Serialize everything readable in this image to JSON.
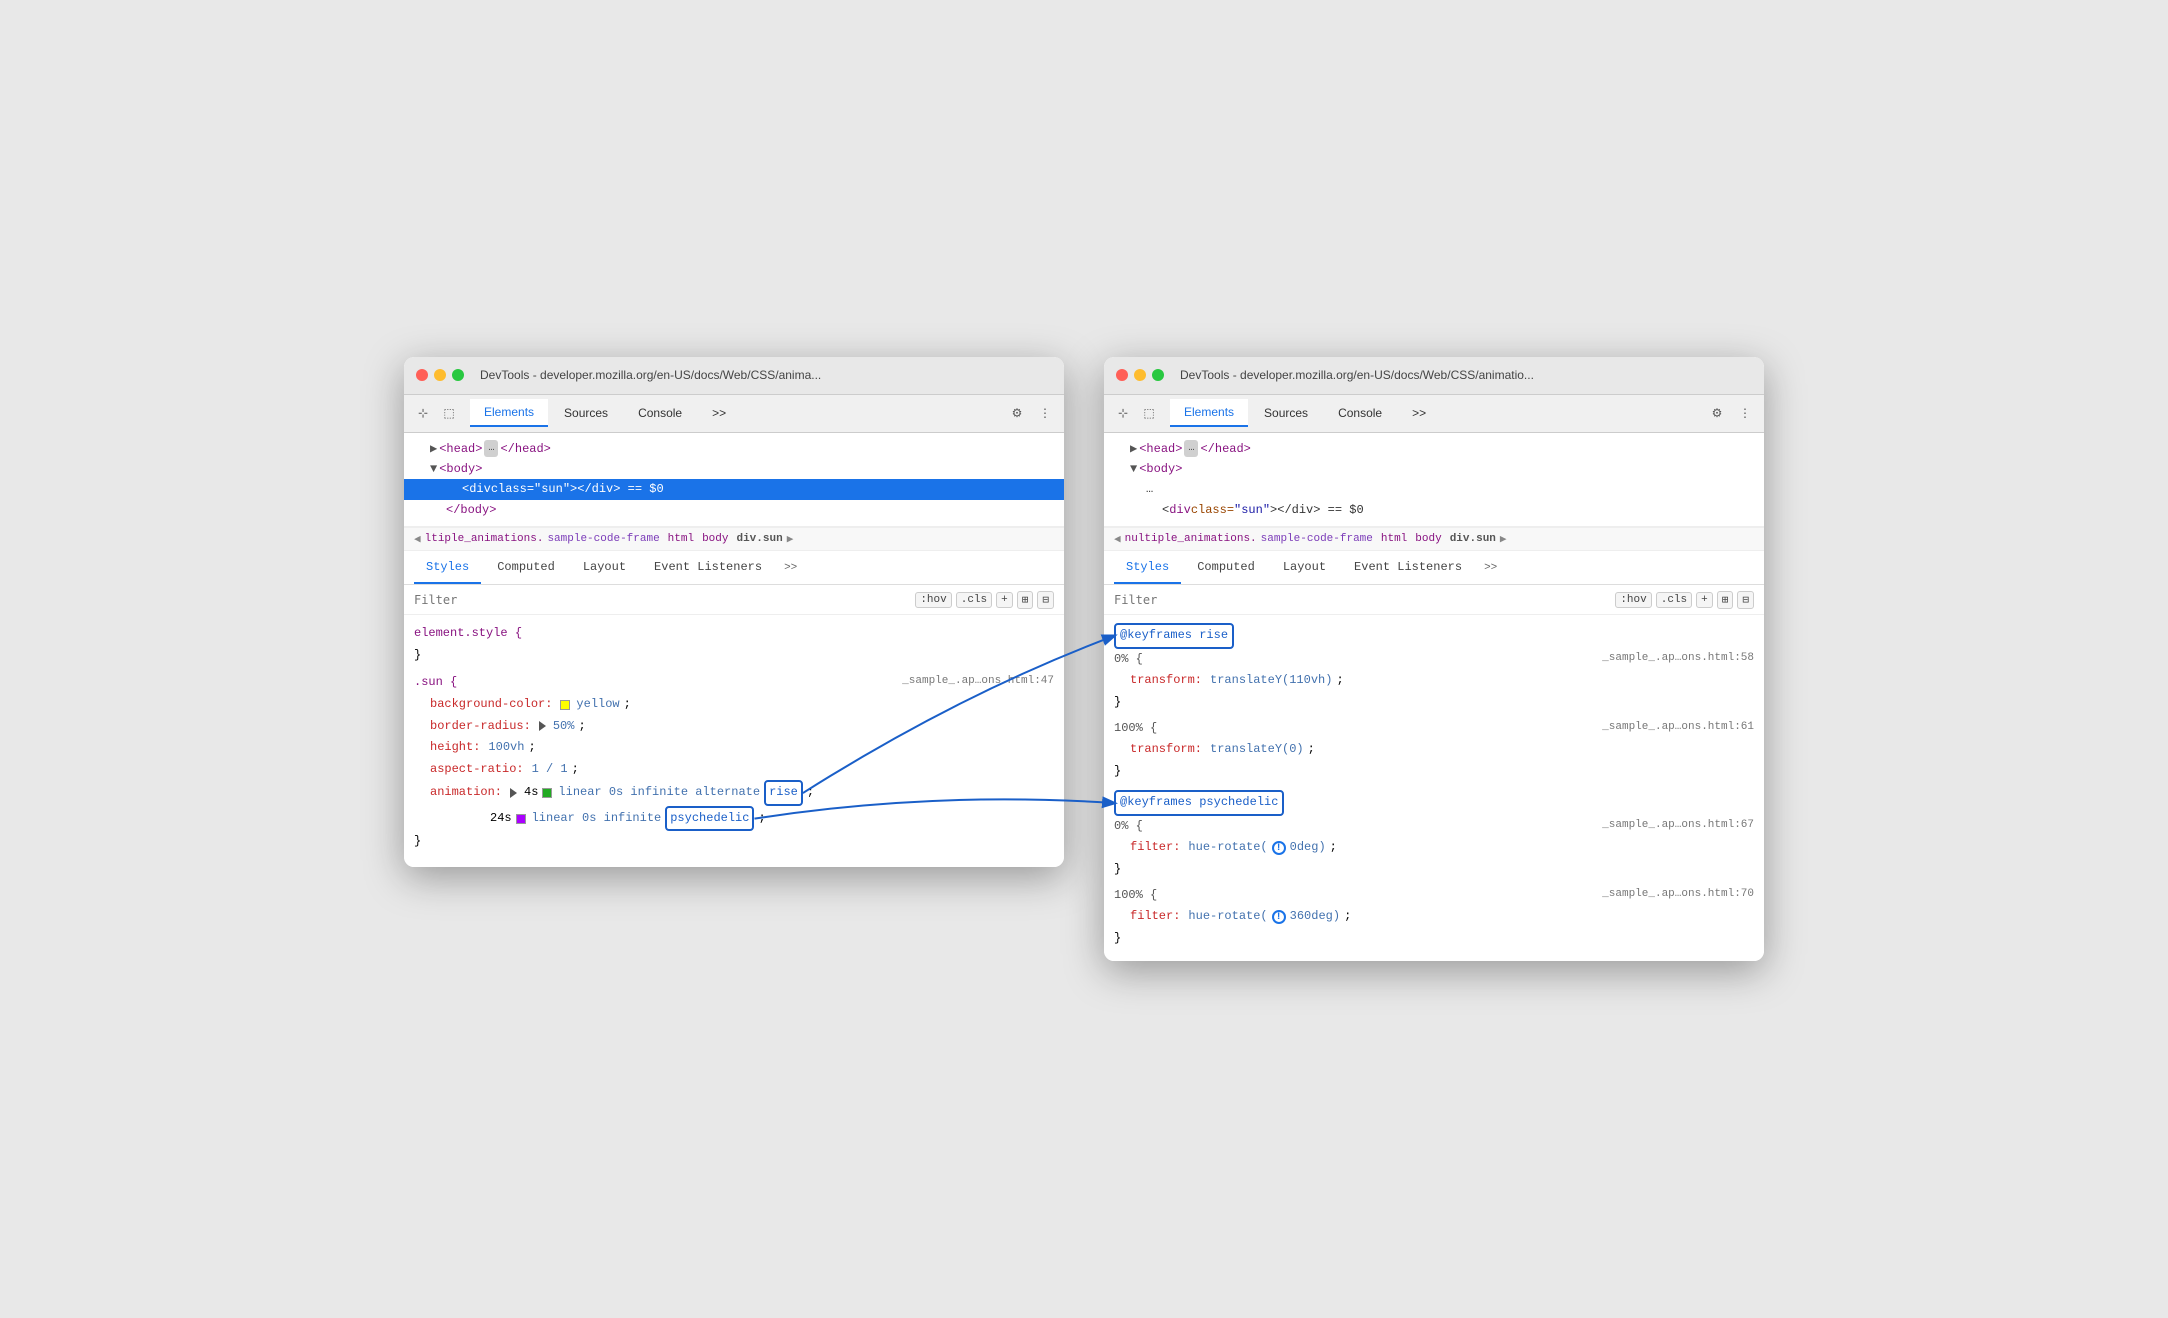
{
  "windows": [
    {
      "id": "left",
      "title": "DevTools - developer.mozilla.org/en-US/docs/Web/CSS/anima...",
      "tabs": [
        "Elements",
        "Sources",
        "Console",
        ">>"
      ],
      "active_tab": "Elements",
      "dom": {
        "lines": [
          {
            "text": "<head>",
            "tag": "head",
            "indent": 1,
            "has_ellipsis": true,
            "ellipsis_after": true,
            "close": "</head>",
            "inline": true
          },
          {
            "text": "<body>",
            "tag": "body",
            "indent": 1,
            "expand": "down"
          },
          {
            "text": "<div class=\"sun\"></div>",
            "indent": 2,
            "selected": true,
            "eq": "== $0"
          },
          {
            "text": "</body>",
            "indent": 1
          }
        ]
      },
      "breadcrumb": {
        "arrow": "◀",
        "items": [
          "ltiple_animations.",
          "sample-code-frame",
          "html",
          "body",
          "div.sun"
        ],
        "arrow_right": "▶"
      },
      "sub_tabs": [
        "Styles",
        "Computed",
        "Layout",
        "Event Listeners",
        ">>"
      ],
      "active_sub_tab": "Styles",
      "filter_placeholder": "Filter",
      "filter_btns": [
        ":hov",
        ".cls",
        "+"
      ],
      "css_rules": [
        {
          "selector": "element.style {",
          "lines": [
            "}"
          ],
          "file": ""
        },
        {
          "selector": ".sun {",
          "file": "_sample_.ap…ons.html:47",
          "props": [
            {
              "name": "background-color:",
              "value": "yellow",
              "swatch": "yellow"
            },
            {
              "name": "border-radius:",
              "value": "▶ 50%;"
            },
            {
              "name": "height:",
              "value": "100vh;"
            },
            {
              "name": "aspect-ratio:",
              "value": "1 / 1;"
            },
            {
              "name": "animation:",
              "value_parts": [
                "▶ 4s",
                "linear 0s infinite alternate",
                "rise"
              ]
            },
            {
              "name": "",
              "value_parts": [
                "24s",
                "linear 0s infinite",
                "psychedelic"
              ],
              "swatch": "purple"
            }
          ],
          "close": "}"
        }
      ]
    },
    {
      "id": "right",
      "title": "DevTools - developer.mozilla.org/en-US/docs/Web/CSS/animatio...",
      "tabs": [
        "Elements",
        "Sources",
        "Console",
        ">>"
      ],
      "active_tab": "Elements",
      "dom": {
        "lines": [
          {
            "text": "<head>",
            "tag": "head",
            "indent": 1,
            "has_ellipsis": true,
            "ellipsis_after": true,
            "close": "</head>",
            "inline": true
          },
          {
            "text": "<body>",
            "tag": "body",
            "indent": 1,
            "expand": "down"
          },
          {
            "text": "...",
            "indent": 2,
            "ellipsis_only": true
          },
          {
            "text": "<div class=\"sun\"></div>",
            "indent": 2,
            "eq": "== $0"
          }
        ]
      },
      "breadcrumb": {
        "arrow": "◀",
        "items": [
          "nultiple_animations.",
          "sample-code-frame",
          "html",
          "body",
          "div.sun"
        ],
        "arrow_right": "▶"
      },
      "sub_tabs": [
        "Styles",
        "Computed",
        "Layout",
        "Event Listeners",
        ">>"
      ],
      "active_sub_tab": "Styles",
      "filter_placeholder": "Filter",
      "filter_btns": [
        ":hov",
        ".cls",
        "+"
      ],
      "keyframe_rules": [
        {
          "selector": "@keyframes rise",
          "highlighted": true,
          "steps": [
            {
              "percent": "0% {",
              "file": "_sample_.ap…ons.html:58",
              "props": [
                {
                  "name": "transform:",
                  "value": "translateY(110vh);"
                }
              ],
              "close": "}"
            },
            {
              "percent": "100% {",
              "file": "_sample_.ap…ons.html:61",
              "props": [
                {
                  "name": "transform:",
                  "value": "translateY(0);"
                }
              ],
              "close": "}"
            }
          ]
        },
        {
          "selector": "@keyframes psychedelic",
          "highlighted": true,
          "steps": [
            {
              "percent": "0% {",
              "file": "_sample_.ap…ons.html:67",
              "props": [
                {
                  "name": "filter:",
                  "value": "hue-rotate(",
                  "info": true,
                  "value2": "0deg);"
                }
              ],
              "close": "}"
            },
            {
              "percent": "100% {",
              "file": "_sample_.ap…ons.html:70",
              "props": [
                {
                  "name": "filter:",
                  "value": "hue-rotate(",
                  "info": true,
                  "value2": "360deg);"
                }
              ],
              "close": "}"
            }
          ]
        }
      ]
    }
  ],
  "icons": {
    "cursor": "⊹",
    "inspector": "⬚",
    "gear": "⚙",
    "more": "⋮",
    "plus": "+",
    "copy_styles": "⊞",
    "toggle_sidebar": "⊟"
  }
}
